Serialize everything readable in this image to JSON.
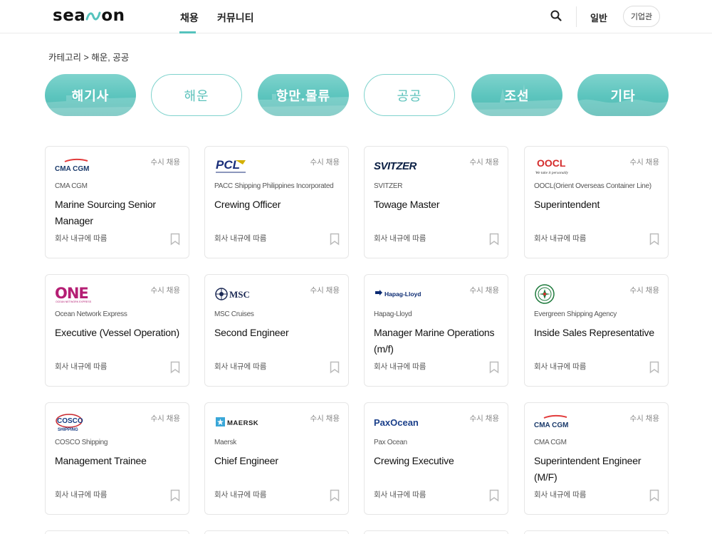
{
  "header": {
    "logo": "seaon",
    "nav": {
      "recruit": "채용",
      "community": "커뮤니티"
    },
    "general": "일반",
    "corp_button": "기업관"
  },
  "breadcrumb": "카테고리 > 해운, 공공",
  "categories": [
    {
      "label": "해기사"
    },
    {
      "label": "해운"
    },
    {
      "label": "항만.물류"
    },
    {
      "label": "공공"
    },
    {
      "label": "조선"
    },
    {
      "label": "기타"
    }
  ],
  "cards": [
    {
      "badge": "수시 채용",
      "logo": "CMA CGM",
      "company": "CMA CGM",
      "title": "Marine Sourcing Senior Manager",
      "salary": "회사 내규에 따름"
    },
    {
      "badge": "수시 채용",
      "logo": "PCL",
      "company": "PACC Shipping Philippines Incorporated",
      "title": "Crewing Officer",
      "salary": "회사 내규에 따름"
    },
    {
      "badge": "수시 채용",
      "logo": "SVITZER",
      "company": "SVITZER",
      "title": "Towage Master",
      "salary": "회사 내규에 따름"
    },
    {
      "badge": "수시 채용",
      "logo": "OOCL",
      "logo_tagline": "We take it personally",
      "company": "OOCL(Orient Overseas Container Line)",
      "title": "Superintendent",
      "salary": "회사 내규에 따름"
    },
    {
      "badge": "수시 채용",
      "logo": "ONE",
      "logo_tagline": "OCEAN NETWORK EXPRESS",
      "company": "Ocean Network Express",
      "title": "Executive (Vessel Operation)",
      "salary": "회사 내규에 따름"
    },
    {
      "badge": "수시 채용",
      "logo": "MSC",
      "company": "MSC Cruises",
      "title": "Second Engineer",
      "salary": "회사 내규에 따름"
    },
    {
      "badge": "수시 채용",
      "logo": "Hapag-Lloyd",
      "company": "Hapag-Lloyd",
      "title": "Manager Marine Operations (m/f)",
      "salary": "회사 내규에 따름"
    },
    {
      "badge": "수시 채용",
      "logo": "",
      "company": "Evergreen Shipping Agency",
      "title": "Inside Sales Representative",
      "salary": "회사 내규에 따름"
    },
    {
      "badge": "수시 채용",
      "logo": "COSCO",
      "logo_tagline": "SHIPPING",
      "company": "COSCO Shipping",
      "title": "Management Trainee",
      "salary": "회사 내규에 따름"
    },
    {
      "badge": "수시 채용",
      "logo": "MAERSK",
      "company": "Maersk",
      "title": "Chief Engineer",
      "salary": "회사 내규에 따름"
    },
    {
      "badge": "수시 채용",
      "logo": "PaxOcean",
      "company": "Pax Ocean",
      "title": "Crewing Executive",
      "salary": "회사 내규에 따름"
    },
    {
      "badge": "수시 채용",
      "logo": "CMA CGM",
      "company": "CMA CGM",
      "title": "Superintendent Engineer (M/F)",
      "salary": "회사 내규에 따름"
    }
  ],
  "colors": {
    "accent": "#55c3bd",
    "pill_fill": "#5bc4bd",
    "border": "#e6e6e6"
  }
}
